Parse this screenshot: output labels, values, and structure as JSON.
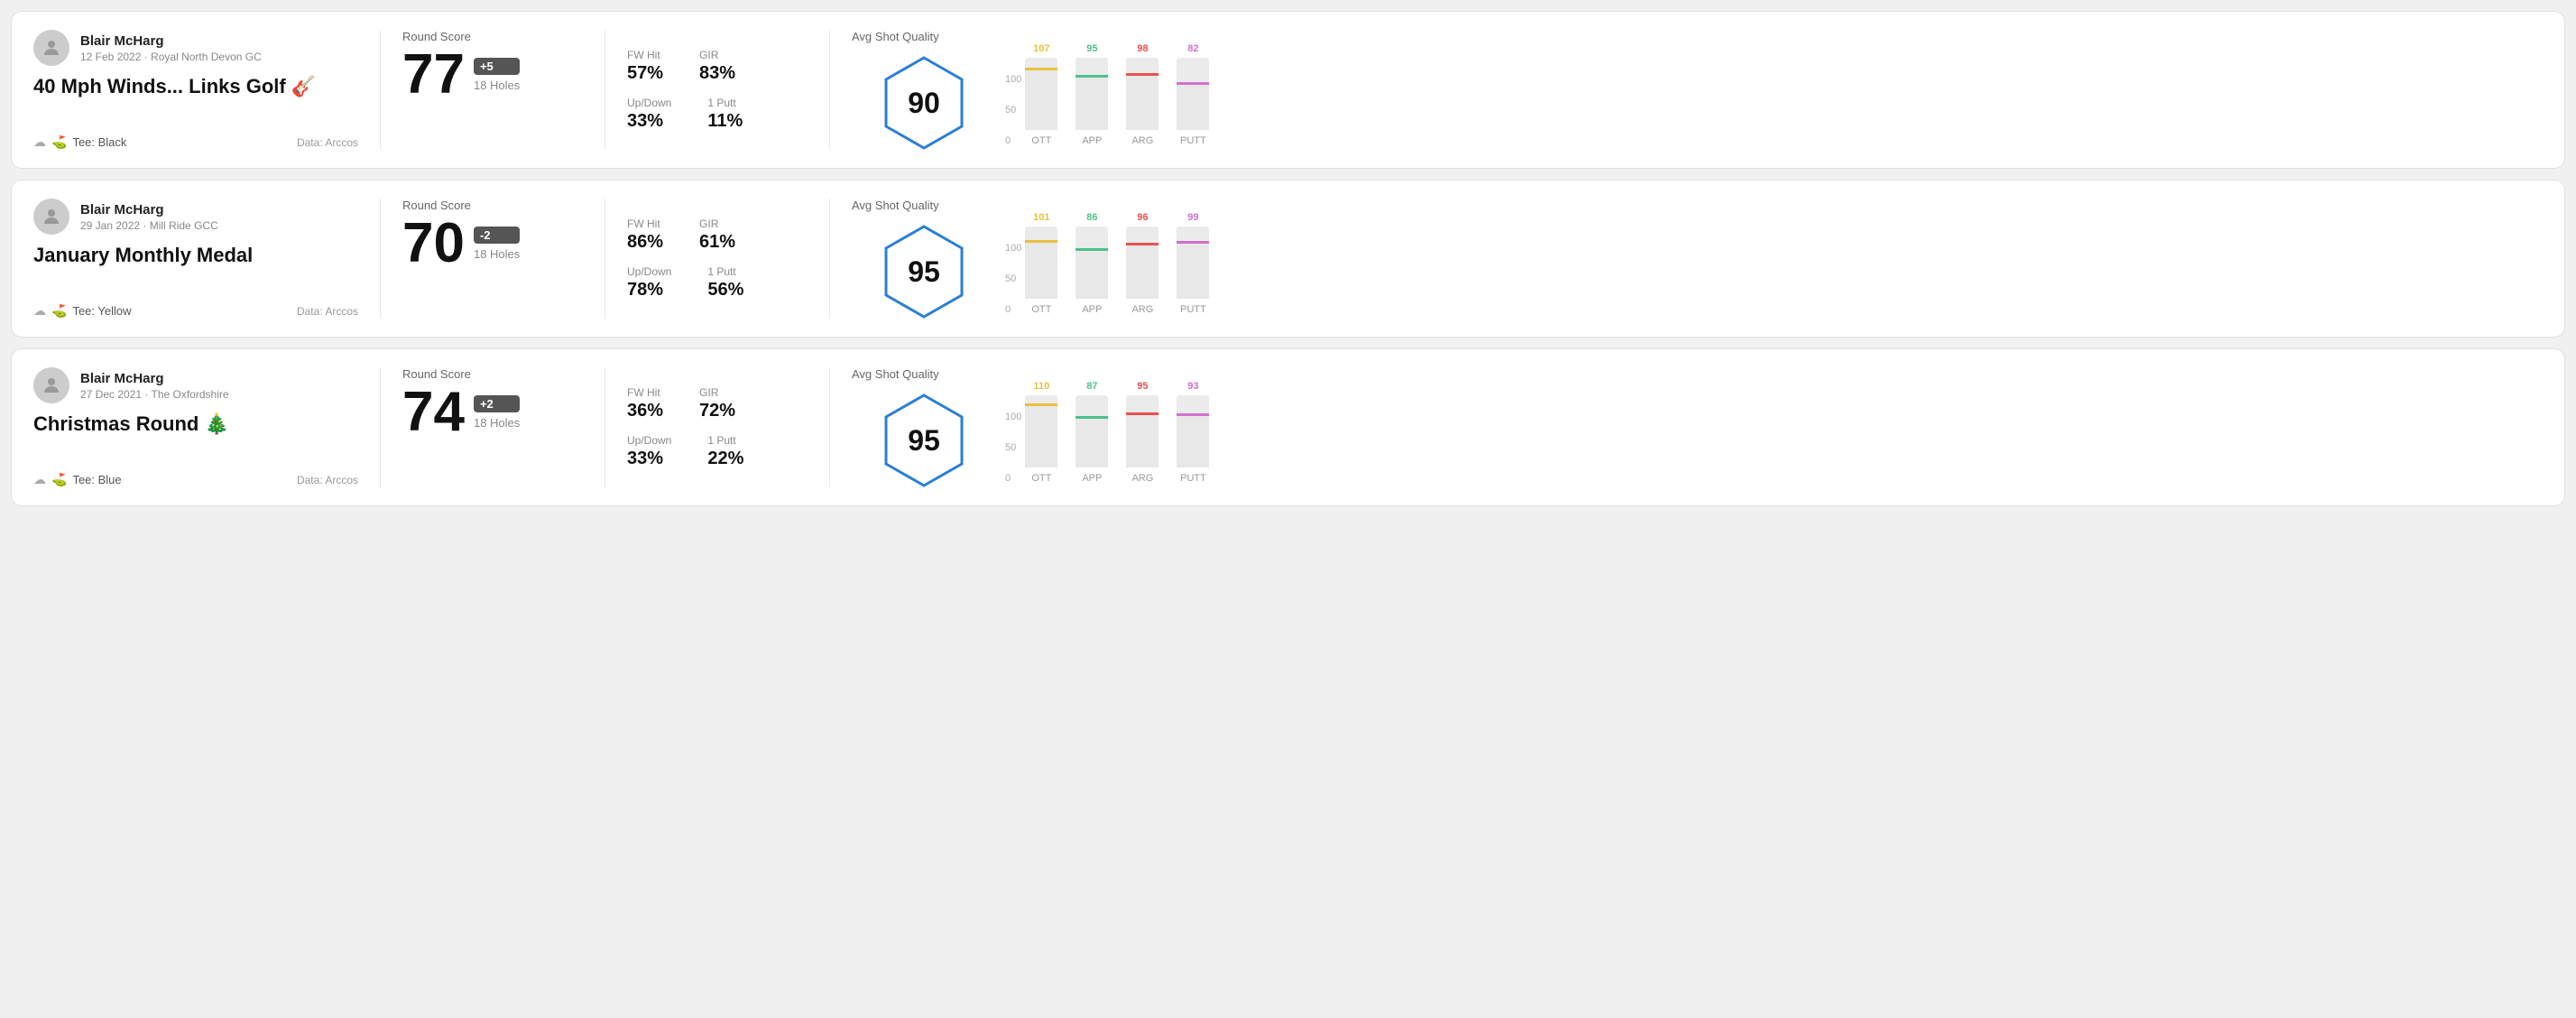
{
  "rounds": [
    {
      "id": "round1",
      "user": {
        "name": "Blair McHarg",
        "date": "12 Feb 2022 · Royal North Devon GC"
      },
      "title": "40 Mph Winds... Links Golf 🎸",
      "tee": "Black",
      "data_source": "Data: Arccos",
      "score": {
        "value": "77",
        "modifier": "+5",
        "holes": "18 Holes"
      },
      "stats": {
        "fw_hit_label": "FW Hit",
        "fw_hit_value": "57%",
        "gir_label": "GIR",
        "gir_value": "83%",
        "updown_label": "Up/Down",
        "updown_value": "33%",
        "one_putt_label": "1 Putt",
        "one_putt_value": "11%"
      },
      "avg_shot_quality": {
        "label": "Avg Shot Quality",
        "score": "90"
      },
      "chart": {
        "bars": [
          {
            "label": "OTT",
            "value": 107,
            "color": "#e8c040",
            "height_pct": 72
          },
          {
            "label": "APP",
            "value": 95,
            "color": "#4dc08c",
            "height_pct": 62
          },
          {
            "label": "ARG",
            "value": 98,
            "color": "#e85050",
            "height_pct": 65
          },
          {
            "label": "PUTT",
            "value": 82,
            "color": "#d070d0",
            "height_pct": 52
          }
        ]
      }
    },
    {
      "id": "round2",
      "user": {
        "name": "Blair McHarg",
        "date": "29 Jan 2022 · Mill Ride GCC"
      },
      "title": "January Monthly Medal",
      "tee": "Yellow",
      "data_source": "Data: Arccos",
      "score": {
        "value": "70",
        "modifier": "-2",
        "holes": "18 Holes"
      },
      "stats": {
        "fw_hit_label": "FW Hit",
        "fw_hit_value": "86%",
        "gir_label": "GIR",
        "gir_value": "61%",
        "updown_label": "Up/Down",
        "updown_value": "78%",
        "one_putt_label": "1 Putt",
        "one_putt_value": "56%"
      },
      "avg_shot_quality": {
        "label": "Avg Shot Quality",
        "score": "95"
      },
      "chart": {
        "bars": [
          {
            "label": "OTT",
            "value": 101,
            "color": "#e8c040",
            "height_pct": 68
          },
          {
            "label": "APP",
            "value": 86,
            "color": "#4dc08c",
            "height_pct": 55
          },
          {
            "label": "ARG",
            "value": 96,
            "color": "#e85050",
            "height_pct": 64
          },
          {
            "label": "PUTT",
            "value": 99,
            "color": "#d070d0",
            "height_pct": 66
          }
        ]
      }
    },
    {
      "id": "round3",
      "user": {
        "name": "Blair McHarg",
        "date": "27 Dec 2021 · The Oxfordshire"
      },
      "title": "Christmas Round 🎄",
      "tee": "Blue",
      "data_source": "Data: Arccos",
      "score": {
        "value": "74",
        "modifier": "+2",
        "holes": "18 Holes"
      },
      "stats": {
        "fw_hit_label": "FW Hit",
        "fw_hit_value": "36%",
        "gir_label": "GIR",
        "gir_value": "72%",
        "updown_label": "Up/Down",
        "updown_value": "33%",
        "one_putt_label": "1 Putt",
        "one_putt_value": "22%"
      },
      "avg_shot_quality": {
        "label": "Avg Shot Quality",
        "score": "95"
      },
      "chart": {
        "bars": [
          {
            "label": "OTT",
            "value": 110,
            "color": "#e8c040",
            "height_pct": 75
          },
          {
            "label": "APP",
            "value": 87,
            "color": "#4dc08c",
            "height_pct": 56
          },
          {
            "label": "ARG",
            "value": 95,
            "color": "#e85050",
            "height_pct": 63
          },
          {
            "label": "PUTT",
            "value": 93,
            "color": "#d070d0",
            "height_pct": 61
          }
        ]
      }
    }
  ],
  "labels": {
    "round_score": "Round Score",
    "avg_shot_quality": "Avg Shot Quality",
    "data_arccos": "Data: Arccos",
    "tee_prefix": "Tee:",
    "y_axis": [
      "100",
      "50",
      "0"
    ]
  }
}
